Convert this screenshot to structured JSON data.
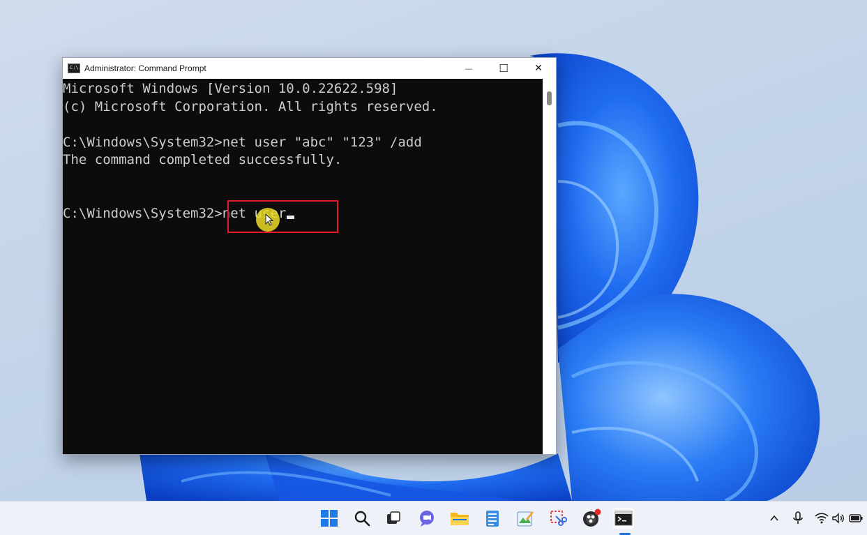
{
  "window": {
    "title": "Administrator: Command Prompt",
    "icon_label": "C:\\.",
    "minimize_glyph": "—",
    "maximize_glyph": "☐",
    "close_glyph": "✕"
  },
  "terminal": {
    "lines": [
      "Microsoft Windows [Version 10.0.22622.598]",
      "(c) Microsoft Corporation. All rights reserved.",
      "",
      "C:\\Windows\\System32>net user \"abc\" \"123\" /add",
      "The command completed successfully.",
      "",
      "",
      "C:\\Windows\\System32>net user"
    ]
  },
  "taskbar": {
    "pinned": [
      {
        "name": "start-icon"
      },
      {
        "name": "search-icon"
      },
      {
        "name": "task-view-icon"
      },
      {
        "name": "chat-icon"
      },
      {
        "name": "file-explorer-icon"
      },
      {
        "name": "notepad-icon"
      },
      {
        "name": "paint-icon"
      },
      {
        "name": "snipping-tool-icon"
      },
      {
        "name": "obs-icon"
      },
      {
        "name": "command-prompt-icon"
      }
    ],
    "tray": [
      {
        "name": "chevron-up-icon"
      },
      {
        "name": "microphone-icon"
      },
      {
        "name": "wifi-icon"
      },
      {
        "name": "volume-icon"
      },
      {
        "name": "battery-icon"
      }
    ]
  },
  "colors": {
    "terminal_bg": "#0c0c0c",
    "terminal_fg": "#cccccc",
    "highlight_box": "#e3182d",
    "accent": "#1d6fd8"
  }
}
